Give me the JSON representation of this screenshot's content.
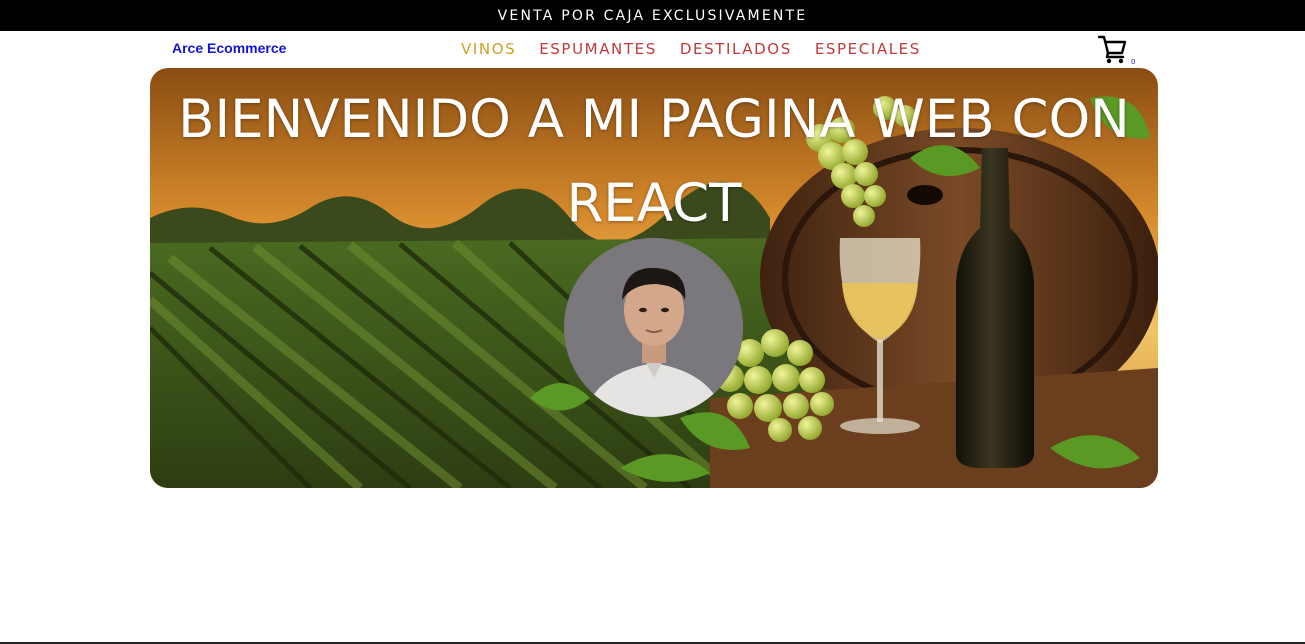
{
  "promo": {
    "text": "VENTA POR CAJA EXCLUSIVAMENTE"
  },
  "nav": {
    "brand": "Arce Ecommerce",
    "links": [
      {
        "label": "VINOS",
        "color": "#c9a227",
        "active": true
      },
      {
        "label": "ESPUMANTES",
        "color": "#c0393b",
        "active": false
      },
      {
        "label": "DESTILADOS",
        "color": "#c0393b",
        "active": false
      },
      {
        "label": "ESPECIALES",
        "color": "#c0393b",
        "active": false
      }
    ],
    "cart": {
      "icon": "cart-icon",
      "count": "0",
      "count_color": "#1414d6"
    }
  },
  "hero": {
    "title": "BIENVENIDO A MI PAGINA WEB CON REACT",
    "background": "vineyard-wine-barrel-image",
    "avatar": "profile-photo"
  },
  "colors": {
    "brand": "#1414d6",
    "active_link": "#c9a227",
    "link": "#c0393b",
    "promo_bg": "#000000"
  }
}
